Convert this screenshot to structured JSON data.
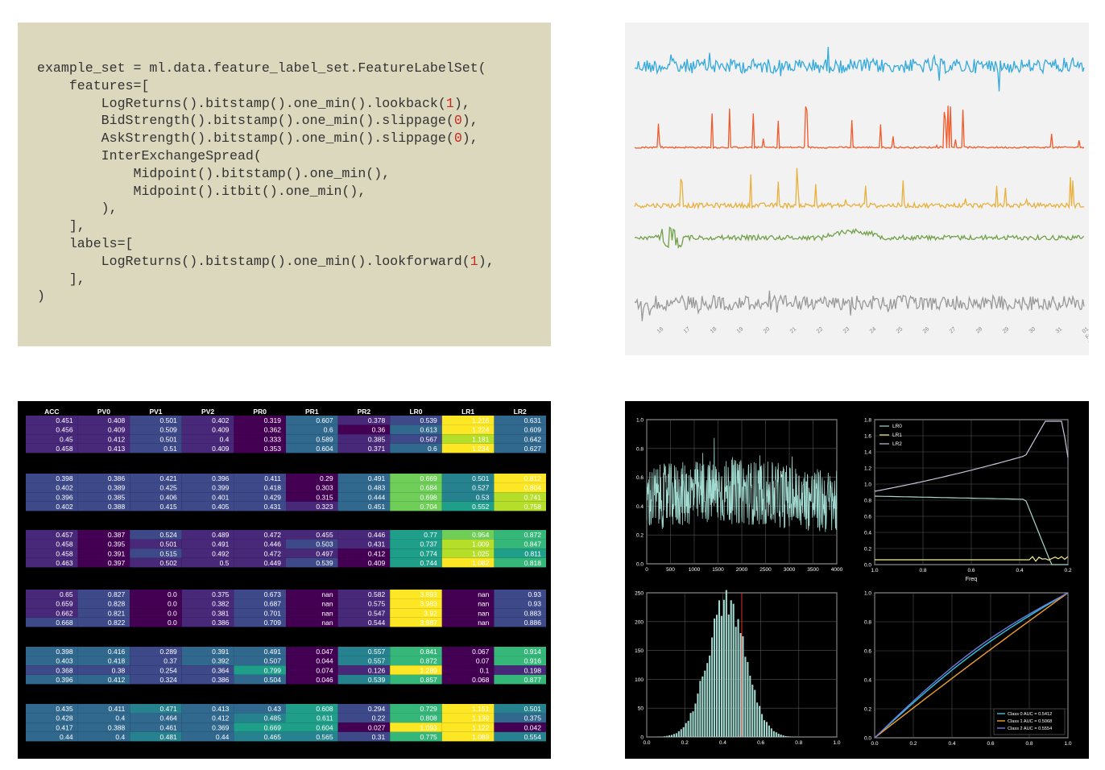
{
  "code": {
    "lines": [
      "example_set = ml.data.feature_label_set.FeatureLabelSet(",
      "    features=[",
      "        LogReturns().bitstamp().one_min().lookback(1),",
      "        BidStrength().bitstamp().one_min().slippage(0),",
      "        AskStrength().bitstamp().one_min().slippage(0),",
      "        InterExchangeSpread(",
      "            Midpoint().bitstamp().one_min(),",
      "            Midpoint().itbit().one_min(),",
      "        ),",
      "    ],",
      "    labels=[",
      "        LogReturns().bitstamp().one_min().lookforward(1),",
      "    ],",
      ")"
    ]
  },
  "timeseries": {
    "colors": [
      "#34a9dc",
      "#f15a2b",
      "#e8b13e",
      "#72a04a",
      "#999999"
    ],
    "x_ticks": [
      "16",
      "17",
      "18",
      "19",
      "20",
      "21",
      "22",
      "23",
      "24",
      "25",
      "26",
      "27",
      "28",
      "29",
      "30",
      "31",
      "01\nFeb\n2016"
    ]
  },
  "heatmap": {
    "columns": [
      "ACC",
      "PV0",
      "PV1",
      "PV2",
      "PR0",
      "PR1",
      "PR2",
      "LR0",
      "LR1",
      "LR2"
    ],
    "groups": [
      [
        [
          "0.451",
          "0.408",
          "0.501",
          "0.402",
          "0.319",
          "0.607",
          "0.378",
          "0.539",
          "1.216",
          "0.631"
        ],
        [
          "0.456",
          "0.409",
          "0.509",
          "0.409",
          "0.362",
          "0.6",
          "0.36",
          "0.613",
          "1.224",
          "0.609"
        ],
        [
          "0.45",
          "0.412",
          "0.501",
          "0.4",
          "0.333",
          "0.589",
          "0.385",
          "0.567",
          "1.181",
          "0.642"
        ],
        [
          "0.458",
          "0.413",
          "0.51",
          "0.409",
          "0.353",
          "0.604",
          "0.371",
          "0.6",
          "1.234",
          "0.627"
        ]
      ],
      [
        [
          "0.398",
          "0.386",
          "0.421",
          "0.396",
          "0.411",
          "0.29",
          "0.491",
          "0.669",
          "0.501",
          "0.812"
        ],
        [
          "0.402",
          "0.389",
          "0.425",
          "0.399",
          "0.418",
          "0.303",
          "0.483",
          "0.684",
          "0.527",
          "0.804"
        ],
        [
          "0.396",
          "0.385",
          "0.406",
          "0.401",
          "0.429",
          "0.315",
          "0.444",
          "0.698",
          "0.53",
          "0.741"
        ],
        [
          "0.402",
          "0.388",
          "0.415",
          "0.405",
          "0.431",
          "0.323",
          "0.451",
          "0.704",
          "0.552",
          "0.758"
        ]
      ],
      [
        [
          "0.457",
          "0.387",
          "0.524",
          "0.489",
          "0.472",
          "0.455",
          "0.446",
          "0.77",
          "0.954",
          "0.872"
        ],
        [
          "0.458",
          "0.395",
          "0.501",
          "0.491",
          "0.446",
          "0.503",
          "0.431",
          "0.737",
          "1.009",
          "0.847"
        ],
        [
          "0.458",
          "0.391",
          "0.515",
          "0.492",
          "0.472",
          "0.497",
          "0.412",
          "0.774",
          "1.025",
          "0.811"
        ],
        [
          "0.463",
          "0.397",
          "0.502",
          "0.5",
          "0.449",
          "0.539",
          "0.409",
          "0.744",
          "1.082",
          "0.818"
        ]
      ],
      [
        [
          "0.65",
          "0.827",
          "0.0",
          "0.375",
          "0.673",
          "nan",
          "0.582",
          "3.893",
          "nan",
          "0.93"
        ],
        [
          "0.659",
          "0.828",
          "0.0",
          "0.382",
          "0.687",
          "nan",
          "0.575",
          "3.983",
          "nan",
          "0.93"
        ],
        [
          "0.662",
          "0.821",
          "0.0",
          "0.381",
          "0.701",
          "nan",
          "0.547",
          "3.92",
          "nan",
          "0.883"
        ],
        [
          "0.668",
          "0.822",
          "0.0",
          "0.386",
          "0.709",
          "nan",
          "0.544",
          "3.987",
          "nan",
          "0.886"
        ]
      ],
      [
        [
          "0.398",
          "0.416",
          "0.289",
          "0.391",
          "0.491",
          "0.047",
          "0.557",
          "0.841",
          "0.067",
          "0.914"
        ],
        [
          "0.403",
          "0.418",
          "0.37",
          "0.392",
          "0.507",
          "0.044",
          "0.557",
          "0.872",
          "0.07",
          "0.916"
        ],
        [
          "0.368",
          "0.38",
          "0.254",
          "0.364",
          "0.799",
          "0.074",
          "0.126",
          "1.289",
          "0.1",
          "0.198"
        ],
        [
          "0.396",
          "0.412",
          "0.324",
          "0.386",
          "0.504",
          "0.046",
          "0.539",
          "0.857",
          "0.068",
          "0.877"
        ]
      ],
      [
        [
          "0.435",
          "0.411",
          "0.471",
          "0.413",
          "0.43",
          "0.608",
          "0.294",
          "0.729",
          "1.151",
          "0.501"
        ],
        [
          "0.428",
          "0.4",
          "0.464",
          "0.412",
          "0.485",
          "0.611",
          "0.22",
          "0.808",
          "1.139",
          "0.375"
        ],
        [
          "0.417",
          "0.388",
          "0.461",
          "0.369",
          "0.669",
          "0.604",
          "0.027",
          "1.093",
          "1.122",
          "0.042"
        ],
        [
          "0.44",
          "0.4",
          "0.481",
          "0.44",
          "0.465",
          "0.565",
          "0.31",
          "0.775",
          "1.089",
          "0.554"
        ]
      ]
    ]
  },
  "ml_plots": {
    "trace": {
      "x_ticks": [
        "0",
        "500",
        "1000",
        "1500",
        "2000",
        "2500",
        "3000",
        "3500",
        "4000"
      ],
      "y_ticks": [
        "0.0",
        "0.2",
        "0.4",
        "0.6",
        "0.8",
        "1.0"
      ],
      "line_color": "#a1dad0",
      "threshold_color": "#e03030"
    },
    "lr_curves": {
      "xlabel": "Freq",
      "x_ticks": [
        "1.0",
        "0.8",
        "0.6",
        "0.4",
        "0.2"
      ],
      "y_ticks": [
        "0.0",
        "0.2",
        "0.4",
        "0.6",
        "0.8",
        "1.0",
        "1.2",
        "1.4",
        "1.6",
        "1.8"
      ],
      "legend": [
        "LR0",
        "LR1",
        "LR2"
      ],
      "colors": [
        "#a9d6c9",
        "#f2f28b",
        "#c6c6dc"
      ]
    },
    "histogram": {
      "x_ticks": [
        "0.0",
        "0.2",
        "0.4",
        "0.6",
        "0.8",
        "1.0"
      ],
      "y_ticks": [
        "0",
        "50",
        "100",
        "150",
        "200",
        "250"
      ],
      "bar_color": "#a1dad0",
      "marker_color": "#e03030",
      "marker_x": 0.5
    },
    "roc": {
      "x_ticks": [
        "0.0",
        "0.2",
        "0.4",
        "0.6",
        "0.8",
        "1.0"
      ],
      "y_ticks": [
        "0.0",
        "0.2",
        "0.4",
        "0.6",
        "0.8",
        "1.0"
      ],
      "legend": [
        "Class 0 AUC = 0.5412",
        "Class 1 AUC = 0.5068",
        "Class 2 AUC = 0.5554"
      ],
      "colors": [
        "#30c8e0",
        "#f0a030",
        "#6a7ae0"
      ]
    }
  }
}
